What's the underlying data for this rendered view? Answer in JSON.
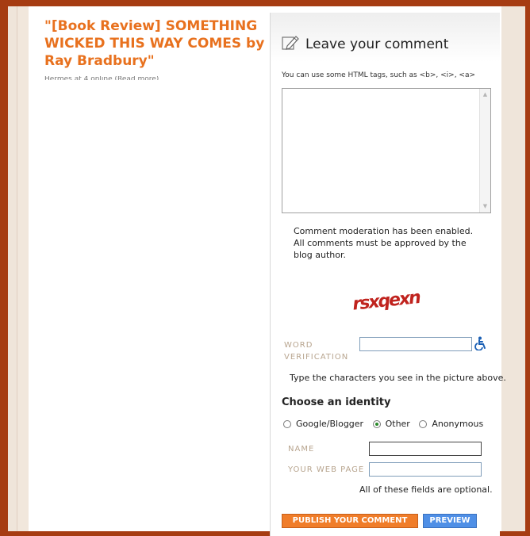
{
  "post": {
    "title": "\"[Book Review] SOMETHING WICKED THIS WAY COMES by Ray Bradbury\"",
    "meta": "Hermes at 4 online (Read more)"
  },
  "comment_form": {
    "title": "Leave your comment",
    "html_hint": "You can use some HTML tags, such as <b>, <i>, <a>",
    "textarea_value": "",
    "moderation_notice": "Comment moderation has been enabled. All comments must be approved by the blog author.",
    "captcha_text": "rsxqexn",
    "word_verification_label": "WORD VERIFICATION",
    "word_verification_value": "",
    "word_verification_hint": "Type the characters you see in the picture above.",
    "identity_title": "Choose an identity",
    "identity_options": [
      "Google/Blogger",
      "Other",
      "Anonymous"
    ],
    "identity_selected": "Other",
    "name_label": "NAME",
    "name_value": "",
    "webpage_label": "YOUR WEB PAGE",
    "webpage_value": "",
    "optional_note": "All of these fields are optional.",
    "publish_label": "PUBLISH YOUR COMMENT",
    "preview_label": "PREVIEW"
  },
  "colors": {
    "border_brown": "#a63c12",
    "title_orange": "#e8711e",
    "publish_orange": "#f07d2a",
    "preview_blue": "#4f8fe6",
    "label_tan": "#b8a58f"
  },
  "icons": [
    "pencil-icon",
    "accessibility-icon",
    "scroll-up-icon",
    "scroll-down-icon"
  ]
}
